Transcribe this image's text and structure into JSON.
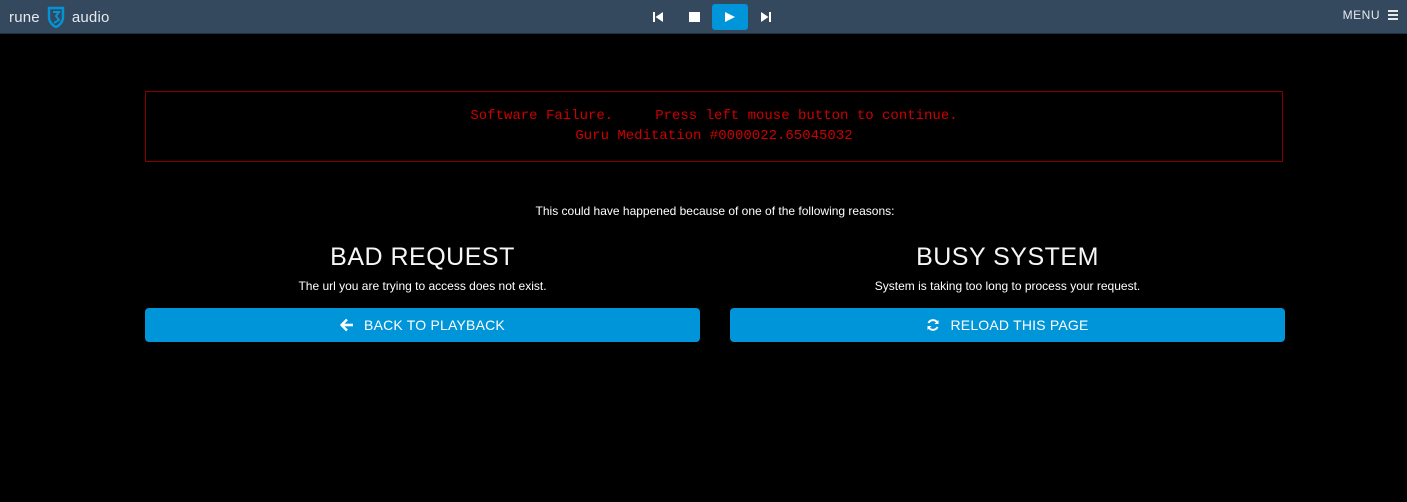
{
  "header": {
    "brand_left": "rune",
    "brand_right": "audio",
    "menu_label": "MENU",
    "controls": [
      {
        "name": "previous",
        "icon": "skip-previous-icon"
      },
      {
        "name": "stop",
        "icon": "stop-icon"
      },
      {
        "name": "play",
        "icon": "play-icon",
        "active": true
      },
      {
        "name": "next",
        "icon": "skip-next-icon"
      }
    ],
    "bar_color": "#34495e",
    "accent_color": "#0095d9"
  },
  "error": {
    "line1": "Software Failure.     Press left mouse button to continue.",
    "line2": "Guru Meditation #0000022.65045032",
    "color": "#cc0000"
  },
  "intro": "This could have happened because of one of the following reasons:",
  "reasons": [
    {
      "title": "BAD REQUEST",
      "description": "The url you are trying to access does not exist.",
      "button_label": "BACK TO PLAYBACK",
      "button_icon": "arrow-left-icon"
    },
    {
      "title": "BUSY SYSTEM",
      "description": "System is taking too long to process your request.",
      "button_label": "RELOAD THIS PAGE",
      "button_icon": "refresh-icon"
    }
  ]
}
